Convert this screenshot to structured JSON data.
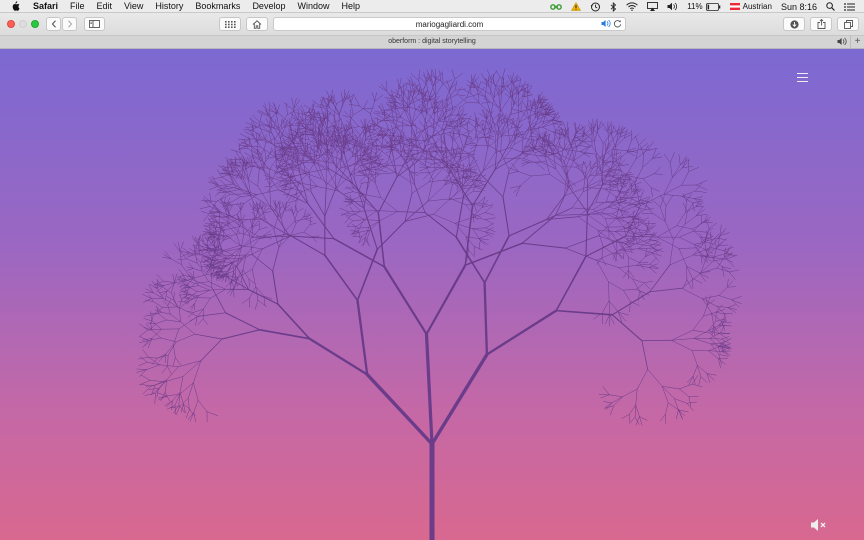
{
  "menubar": {
    "app_name": "Safari",
    "items": [
      "File",
      "Edit",
      "View",
      "History",
      "Bookmarks",
      "Develop",
      "Window",
      "Help"
    ],
    "battery": "11%",
    "input_source": "Austrian",
    "clock": "Sun 8:16"
  },
  "toolbar": {
    "url": "mariogagliardi.com"
  },
  "tabbar": {
    "title": "oberform : digital storytelling",
    "new_tab": "+"
  },
  "colors": {
    "sky_top": "#7c69d2",
    "sky_bottom": "#d8688f",
    "tree": "#6a3c8a"
  }
}
